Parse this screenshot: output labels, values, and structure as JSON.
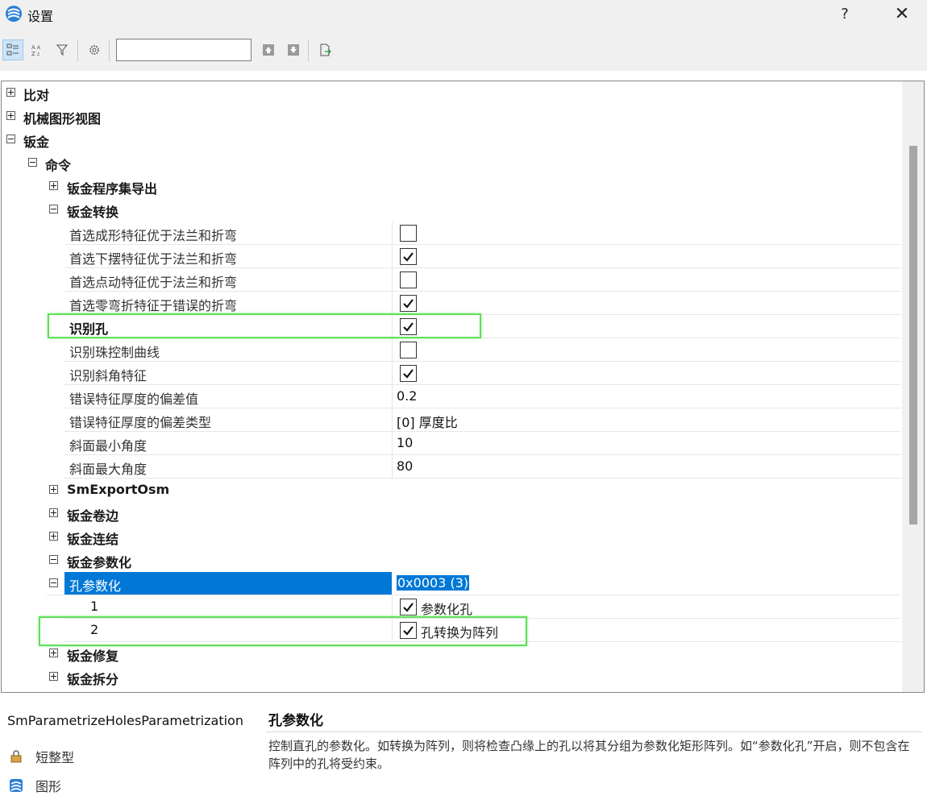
{
  "window": {
    "title": "设置",
    "help_label": "?",
    "close_label": "✕"
  },
  "toolbar": {
    "search_value": "",
    "buttons": [
      "categorized-view",
      "alphabetical-sort",
      "filter",
      "settings",
      "move-up",
      "move-down",
      "export"
    ]
  },
  "tree": {
    "n_bidui": "比对",
    "n_jixie": "机械图形视图",
    "n_banjin": "钣金",
    "n_mingling": "命令",
    "n_chengxu": "钣金程序集导出",
    "n_zhuanhuan": "钣金转换",
    "props": [
      {
        "label": "首选成形特征优于法兰和折弯",
        "checked": false
      },
      {
        "label": "首选下摆特征优于法兰和折弯",
        "checked": true
      },
      {
        "label": "首选点动特征优于法兰和折弯",
        "checked": false
      },
      {
        "label": "首选零弯折特征于错误的折弯",
        "checked": true
      },
      {
        "label": "识别孔",
        "checked": true
      },
      {
        "label": "识别珠控制曲线",
        "checked": false
      },
      {
        "label": "识别斜角特征",
        "checked": true
      },
      {
        "label": "错误特征厚度的偏差值",
        "value": "0.2"
      },
      {
        "label": "错误特征厚度的偏差类型",
        "value": "[0] 厚度比"
      },
      {
        "label": "斜面最小角度",
        "value": "10"
      },
      {
        "label": "斜面最大角度",
        "value": "80"
      }
    ],
    "n_smexport": "SmExportOsm",
    "n_juanbian": "钣金卷边",
    "n_lianjie": "钣金连结",
    "n_canshuhua": "钣金参数化",
    "n_kong": "孔参数化",
    "n_kong_value": "0x0003 (3)",
    "kong_children": [
      {
        "label": "1",
        "text": "参数化孔",
        "checked": true
      },
      {
        "label": "2",
        "text": "孔转换为阵列",
        "checked": true
      }
    ],
    "n_xiufu": "钣金修复",
    "n_chaifen": "钣金拆分"
  },
  "description": {
    "property_id": "SmParametrizeHolesParametrization",
    "title": "孔参数化",
    "text": "控制直孔的参数化。如转换为阵列，则将检查凸缘上的孔以将其分组为参数化矩形阵列。如“参数化孔”开启，则不包含在阵列中的孔将受约束。",
    "type_label": "短整型",
    "category_label": "图形"
  },
  "colors": {
    "selection": "#0078d7",
    "highlight_box": "#5fe05a",
    "panel_bg": "#f0f0f0"
  }
}
